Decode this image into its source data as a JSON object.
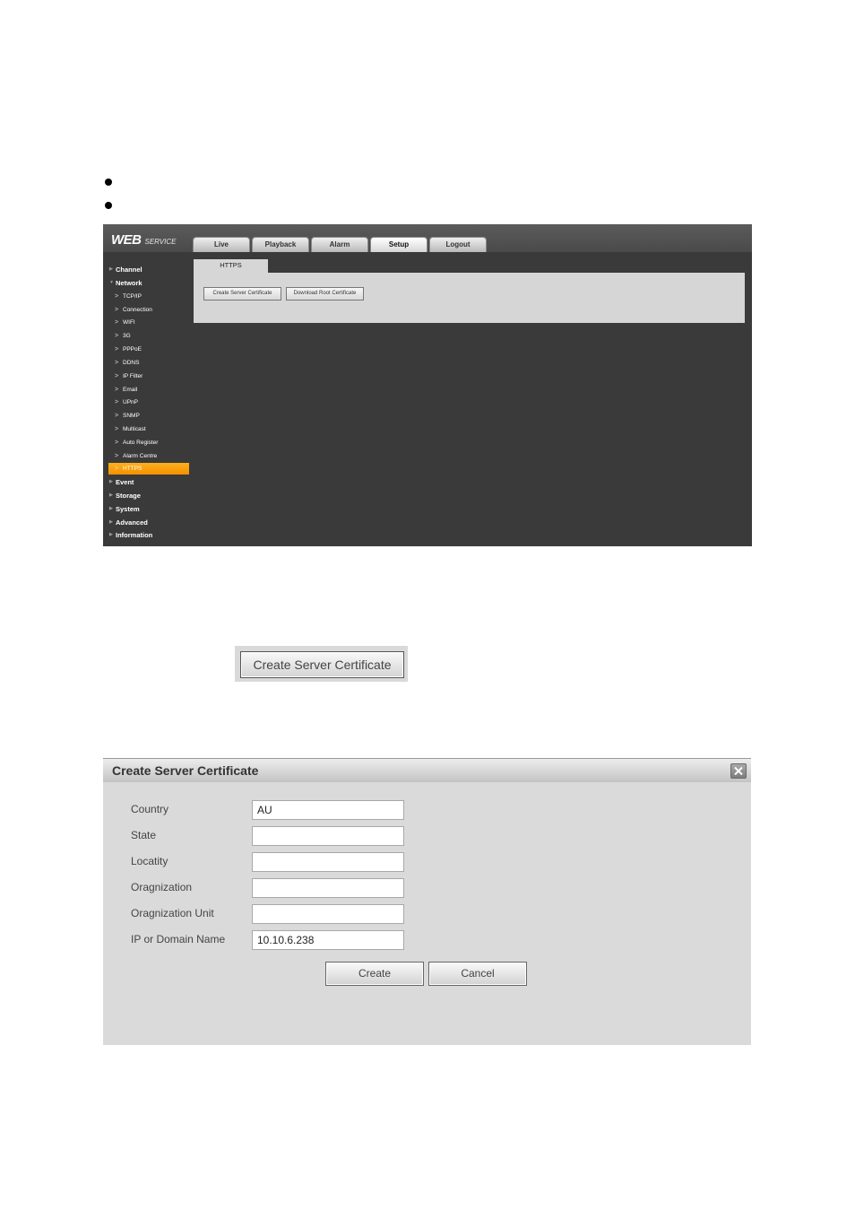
{
  "web": {
    "logo_main": "WEB",
    "logo_sub": "SERVICE",
    "nav": [
      "Live",
      "Playback",
      "Alarm",
      "Setup",
      "Logout"
    ],
    "active_nav": "Setup",
    "sidebar": {
      "channel": "Channel",
      "network": "Network",
      "network_items": [
        "TCP/IP",
        "Connection",
        "WIFI",
        "3G",
        "PPPoE",
        "DDNS",
        "IP Filter",
        "Email",
        "UPnP",
        "SNMP",
        "Multicast",
        "Auto Register",
        "Alarm Centre",
        "HTTPS"
      ],
      "active_item": "HTTPS",
      "event": "Event",
      "storage": "Storage",
      "system": "System",
      "advanced": "Advanced",
      "information": "Information"
    },
    "content_tab": "HTTPS",
    "create_cert_label": "Create Server Certificate",
    "download_root_label": "Download Root Certificate"
  },
  "standalone_button": {
    "label": "Create Server Certificate"
  },
  "dialog": {
    "title": "Create Server Certificate",
    "fields": {
      "country": {
        "label": "Country",
        "value": "AU"
      },
      "state": {
        "label": "State",
        "value": ""
      },
      "locality": {
        "label": "Locatity",
        "value": ""
      },
      "organization": {
        "label": "Oragnization",
        "value": ""
      },
      "org_unit": {
        "label": "Oragnization Unit",
        "value": ""
      },
      "ip_domain": {
        "label": "IP or Domain Name",
        "value": "10.10.6.238"
      }
    },
    "create_label": "Create",
    "cancel_label": "Cancel"
  },
  "colors": {
    "accent": "#f7a21a",
    "panel_dark": "#3a3a3a",
    "panel_light": "#d6d6d6"
  }
}
